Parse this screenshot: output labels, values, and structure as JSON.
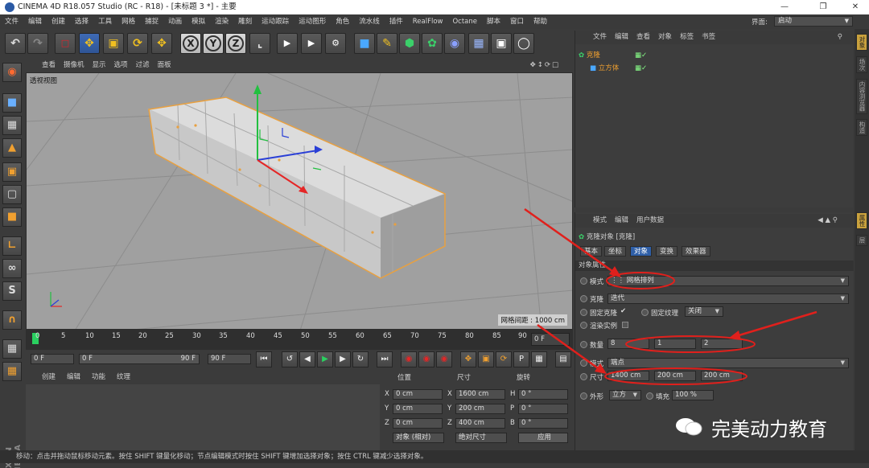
{
  "window": {
    "title": "CINEMA 4D R18.057 Studio (RC - R18) - [未标题 3 *] - 主要"
  },
  "menubar": {
    "items": [
      "文件",
      "编辑",
      "创建",
      "选择",
      "工具",
      "网格",
      "捕捉",
      "动画",
      "模拟",
      "渲染",
      "雕刻",
      "运动跟踪",
      "运动图形",
      "角色",
      "流水线",
      "插件",
      "RealFlow",
      "Octane",
      "脚本",
      "窗口",
      "帮助"
    ],
    "layout_label": "界面:",
    "layout_value": "启动"
  },
  "toolbar": {
    "xyz": [
      "X",
      "Y",
      "Z"
    ]
  },
  "viewport": {
    "menu": [
      "查看",
      "摄像机",
      "显示",
      "选项",
      "过滤",
      "面板"
    ],
    "label": "透视视图",
    "grid_spacing": "网格间距 : 1000 cm"
  },
  "timeline": {
    "ticks": [
      "0",
      "5",
      "10",
      "15",
      "20",
      "25",
      "30",
      "35",
      "40",
      "45",
      "50",
      "55",
      "60",
      "65",
      "70",
      "75",
      "80",
      "85",
      "90"
    ],
    "current_frame": "0 F"
  },
  "transport": {
    "start": "0 F",
    "range_start": "0 F",
    "range_end": "90 F",
    "end": "90 F"
  },
  "material_menu": [
    "创建",
    "编辑",
    "功能",
    "纹理"
  ],
  "coordinates": {
    "headers": [
      "位置",
      "尺寸",
      "旋转"
    ],
    "rows": [
      {
        "axis": "X",
        "pos": "0 cm",
        "size_axis": "X",
        "size": "1600 cm",
        "rot_axis": "H",
        "rot": "0 °"
      },
      {
        "axis": "Y",
        "pos": "0 cm",
        "size_axis": "Y",
        "size": "200 cm",
        "rot_axis": "P",
        "rot": "0 °"
      },
      {
        "axis": "Z",
        "pos": "0 cm",
        "size_axis": "Z",
        "size": "400 cm",
        "rot_axis": "B",
        "rot": "0 °"
      }
    ],
    "mode": "对象 (相对)",
    "size_mode": "绝对尺寸",
    "apply": "应用"
  },
  "object_manager": {
    "menu": [
      "文件",
      "编辑",
      "查看",
      "对象",
      "标签",
      "书签"
    ],
    "objects": [
      "克隆",
      "立方体"
    ]
  },
  "attributes": {
    "menu": [
      "模式",
      "编辑",
      "用户数据"
    ],
    "object_title": "克隆对象 [克隆]",
    "tabs": [
      "基本",
      "坐标",
      "对象",
      "变换",
      "效果器"
    ],
    "active_tab": "对象",
    "section": "对象属性",
    "mode_label": "模式",
    "mode_value": "网格排列",
    "clone_label": "克隆",
    "clone_value": "迭代",
    "fix_clone": "固定克隆",
    "fix_texture": "固定纹理",
    "fix_texture_value": "关闭",
    "render_instances": "渲染实例",
    "count_label": "数量",
    "count": [
      "8",
      "1",
      "2"
    ],
    "mode2_label": "模式",
    "mode2_value": "端点",
    "size_label": "尺寸",
    "size": [
      "1400 cm",
      "200 cm",
      "200 cm"
    ],
    "shape_label": "外形",
    "shape_value": "立方",
    "fill_label": "填充",
    "fill_value": "100 %"
  },
  "side_tabs": [
    "对象",
    "场次",
    "内容浏览器",
    "构造",
    "属性",
    "层"
  ],
  "brand": "MAXON CINEMA 4D",
  "status": "移动：点击并拖动鼠标移动元素。按住 SHIFT 键量化移动；节点编辑模式时按住 SHIFT 键增加选择对象；按住 CTRL 键减少选择对象。",
  "watermark": "完美动力教育",
  "colors": {
    "accent": "#2f5fa7",
    "annotation": "#e0201c",
    "selection": "#e8a040"
  }
}
